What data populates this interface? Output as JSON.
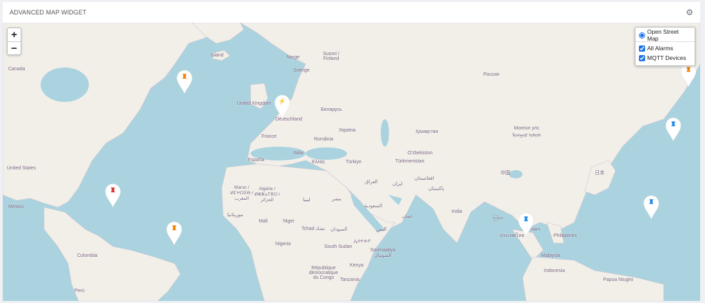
{
  "widget": {
    "title": "ADVANCED MAP WIDGET",
    "settings_icon": "gear-icon"
  },
  "zoom": {
    "in": "+",
    "out": "−"
  },
  "layers": {
    "base": "Open Street Map",
    "overlays": [
      {
        "label": "All Alarms",
        "checked": true
      },
      {
        "label": "MQTT Devices",
        "checked": true
      }
    ]
  },
  "labels": [
    "Canada",
    "Island",
    "Norge",
    "Suomi / Finland",
    "Sverige",
    "United Kingdom",
    "Deutschland",
    "Беларусь",
    "Україна",
    "Россия",
    "France",
    "România",
    "Қазақстан",
    "Монгол улс ᠮᠣᠩᠭᠣᠯ ᠤᠯᠤᠰ",
    "Italia",
    "España",
    "Ελλάς",
    "Türkiye",
    "O'zbekiston",
    "Türkmenistan",
    "United States",
    "中国",
    "日本",
    "Maroc / ⵍⵎⵖⵔⵉⴱ / المغرب",
    "Algérie / ⵍⵣⵣⴰⵢⴻⵔ / الجزائر",
    "ليبيا",
    "مصر",
    "العراق",
    "ایران",
    "افغانستان",
    "پاکستان",
    "السعودية",
    "México",
    "موريتانيا",
    "Mali",
    "Niger",
    "Tchad تشاد",
    "السودان",
    "اليمن",
    "عمان",
    "India",
    "မြန်မာ",
    "Philippines",
    "Nigeria",
    "South Sudan",
    "ኢትዮጵያ",
    "Soomaaliya الصومال",
    "Kenya",
    "Colombia",
    "République démocratique du Congo",
    "Tanzania",
    "Malaysia",
    "Indonesia",
    "Papua Niugini",
    "Perú",
    "ประเทศไทย",
    "Việt Nam"
  ],
  "markers": [
    {
      "type": "alarm",
      "color": "#f57c00"
    },
    {
      "type": "device",
      "color": "#222222"
    },
    {
      "type": "alarm",
      "color": "#d32f2f"
    },
    {
      "type": "alarm",
      "color": "#f57c00"
    },
    {
      "type": "alarm",
      "color": "#1e88e5"
    },
    {
      "type": "alarm",
      "color": "#1e88e5"
    },
    {
      "type": "alarm",
      "color": "#1e88e5"
    },
    {
      "type": "alarm",
      "color": "#f57c00"
    }
  ]
}
